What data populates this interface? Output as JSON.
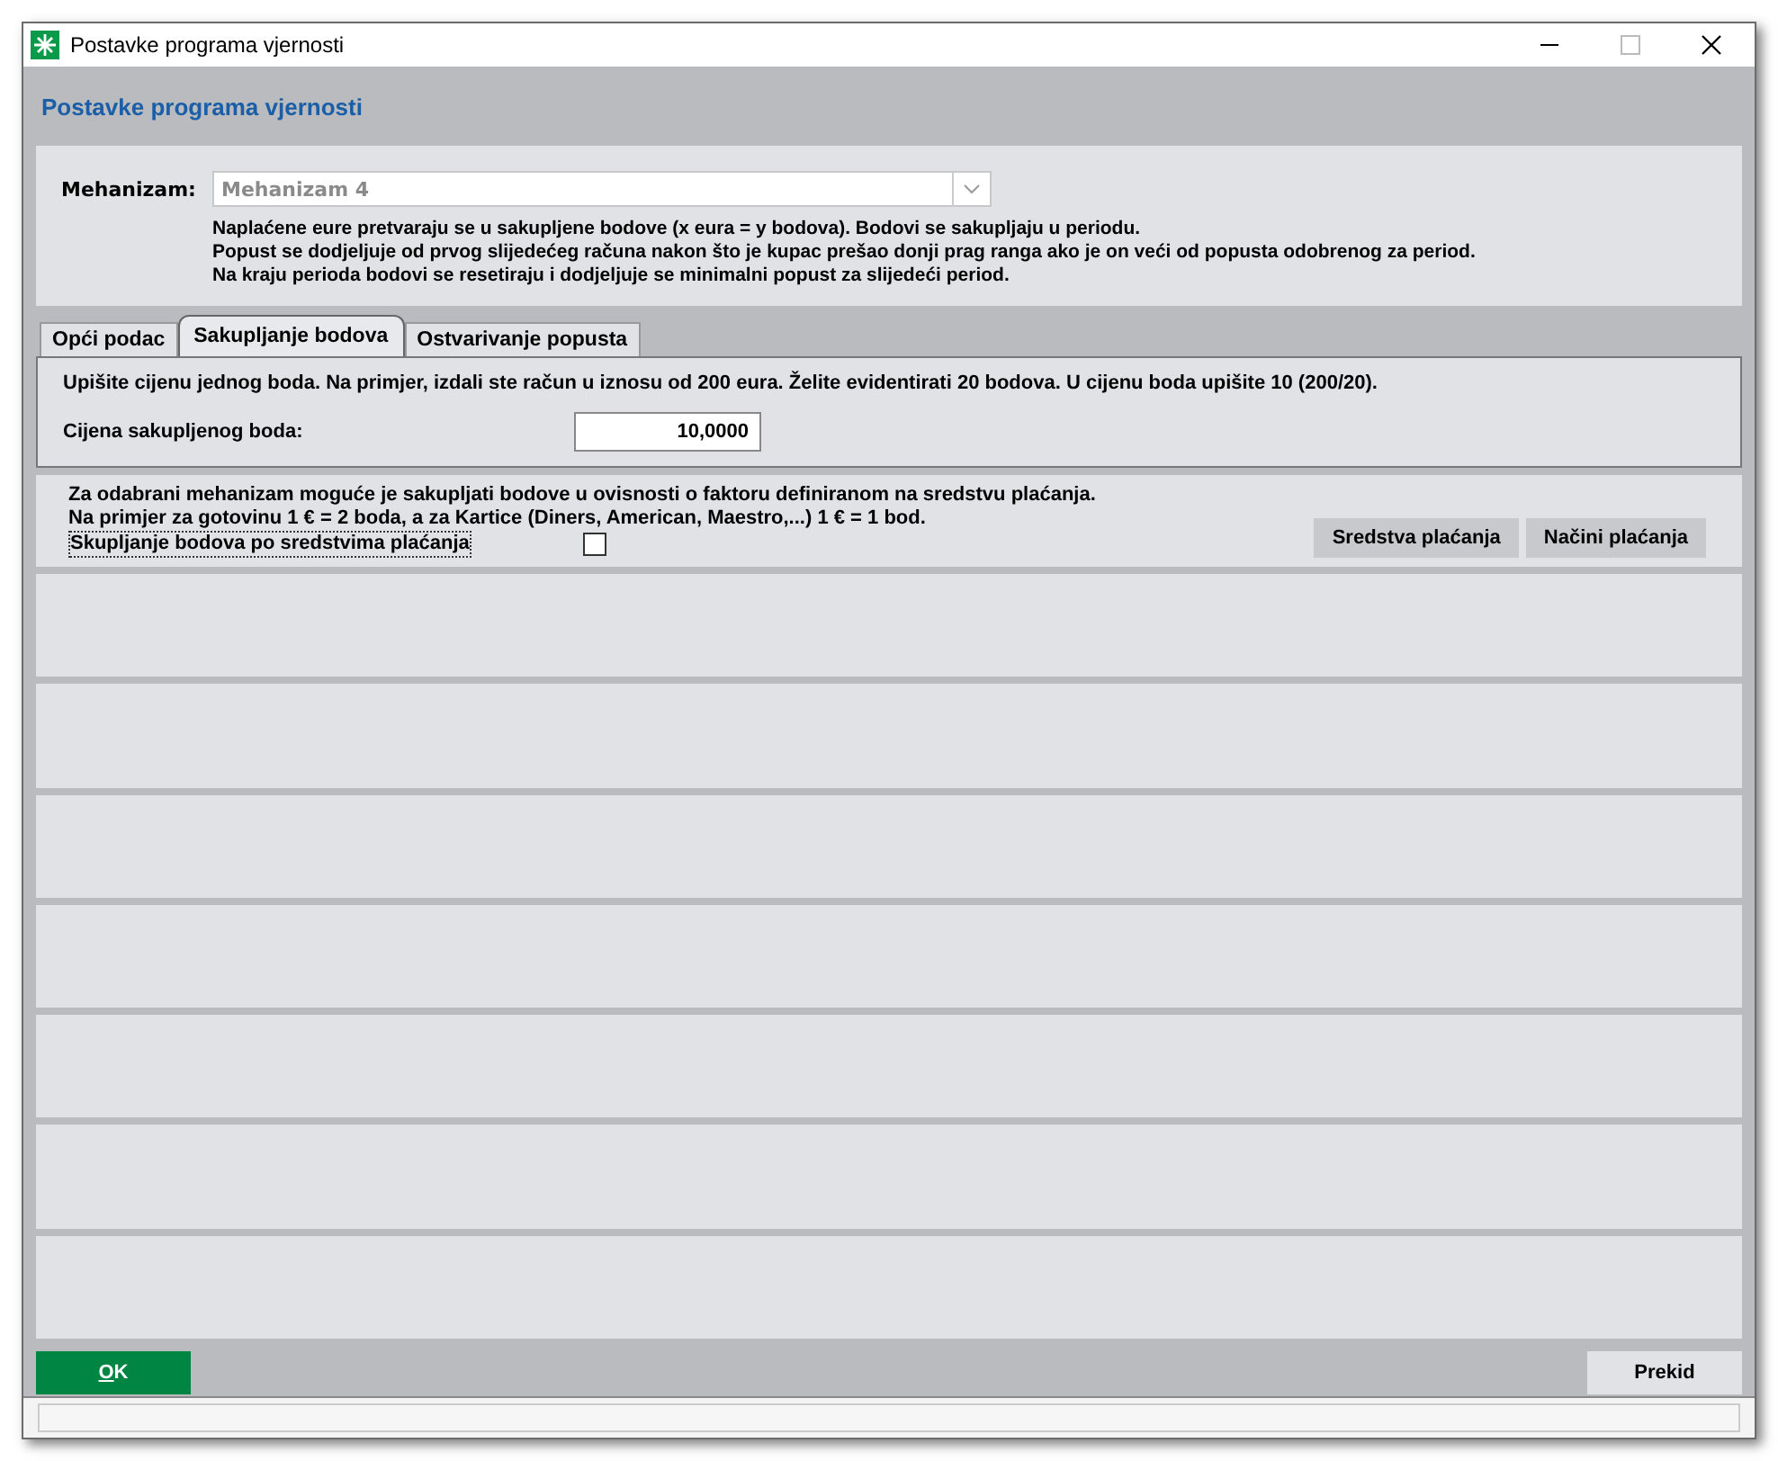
{
  "window": {
    "title": "Postavke programa vjernosti"
  },
  "header": {
    "title": "Postavke programa vjernosti"
  },
  "mechanism": {
    "label": "Mehanizam:",
    "value": "Mehanizam 4",
    "disabled": true,
    "description": [
      "Naplaćene eure pretvaraju se u sakupljene bodove (x eura = y bodova). Bodovi se sakupljaju u periodu.",
      "Popust se dodjeljuje od prvog slijedećeg računa nakon što je kupac prešao donji prag ranga ako je on veći od popusta odobrenog za period.",
      "Na kraju perioda bodovi se resetiraju i dodjeljuje se minimalni popust za slijedeći period."
    ]
  },
  "tabs": [
    {
      "label": "Opći podac",
      "selected": false
    },
    {
      "label": "Sakupljanje bodova",
      "selected": true
    },
    {
      "label": "Ostvarivanje popusta",
      "selected": false
    }
  ],
  "tab_panel": {
    "hint": "Upišite cijenu jednog boda. Na primjer, izdali ste račun u iznosu od 200 eura. Želite evidentirati 20 bodova. U cijenu boda upišite 10 (200/20).",
    "price_label": "Cijena sakupljenog boda:",
    "price_value": "10,0000"
  },
  "payment": {
    "description": [
      "Za odabrani mehanizam moguće je sakupljati bodove u ovisnosti o faktoru definiranom na sredstvu plaćanja.",
      "Na primjer za gotovinu 1 € = 2 boda, a za Kartice (Diners, American, Maestro,...) 1 € = 1 bod."
    ],
    "checkbox_label": "Skupljanje bodova po sredstvima plaćanja",
    "checked": false,
    "buttons": [
      "Sredstva plaćanja",
      "Načini plaćanja"
    ]
  },
  "footer": {
    "ok": "OK",
    "cancel": "Prekid"
  }
}
